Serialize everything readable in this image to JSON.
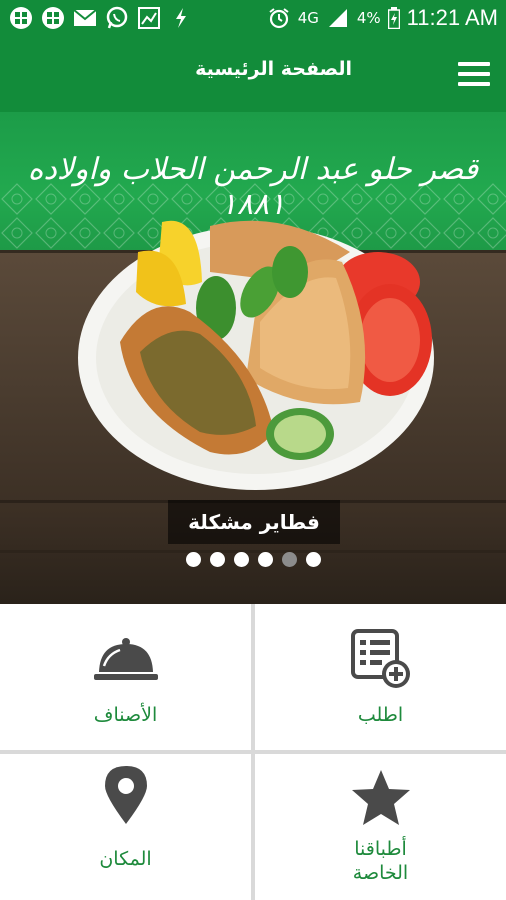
{
  "status_bar": {
    "network": "4G",
    "battery": "4%",
    "time": "11:21 AM"
  },
  "app_bar": {
    "title": "الصفحة الرئيسية"
  },
  "banner": {
    "headline": "قصر حلو عبد الرحمن الحلاب واولاده ١٨٨١",
    "caption": "فطاير مشكلة",
    "slide_count": 6,
    "active_slide_index": 4
  },
  "grid": {
    "order_label": "اطلب",
    "categories_label": "الأصناف",
    "specials_label_line1": "أطباقنا",
    "specials_label_line2": "الخاصة",
    "location_label": "المكان"
  },
  "colors": {
    "primary_green": "#128c3a",
    "label_green": "#1e8a3c",
    "icon_gray": "#4a4a4a"
  },
  "icons": {
    "order": "order-list-add-icon",
    "categories": "serving-cloche-icon",
    "specials": "star-icon",
    "location": "map-pin-icon"
  }
}
